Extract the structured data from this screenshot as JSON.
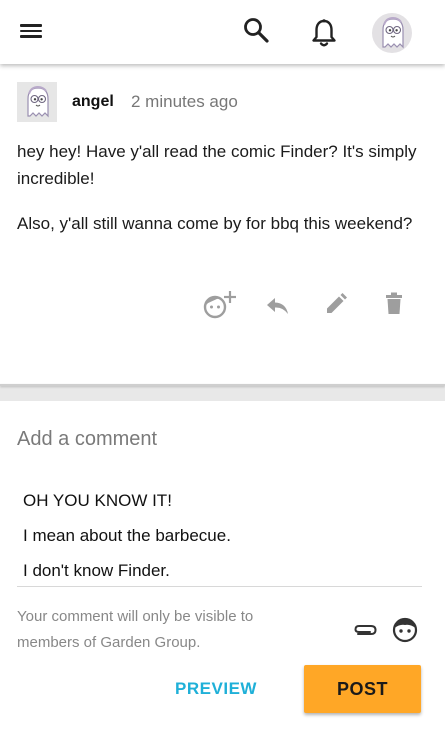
{
  "appbar": {
    "icons": [
      "menu-icon",
      "search-icon",
      "bell-icon",
      "avatar"
    ]
  },
  "post": {
    "author": "angel",
    "timestamp": "2 minutes ago",
    "paragraphs": [
      "hey hey! Have y'all read the comic Finder? It's simply incredible!",
      "Also, y'all still wanna come by for bbq this weekend?"
    ],
    "actions": [
      "add-reaction-icon",
      "reply-icon",
      "edit-icon",
      "delete-icon"
    ]
  },
  "comment": {
    "placeholder": "Add a comment",
    "draft_lines": [
      "OH YOU KNOW IT!",
      "I mean about the barbecue.",
      "I don't know Finder."
    ],
    "visibility_note": "Your comment will only be visible to members of Garden Group.",
    "preview_label": "PREVIEW",
    "post_label": "POST"
  },
  "colors": {
    "accent": "#1fb0d8",
    "post_button": "#ffa726",
    "icon_gray": "#9e9e9e"
  }
}
